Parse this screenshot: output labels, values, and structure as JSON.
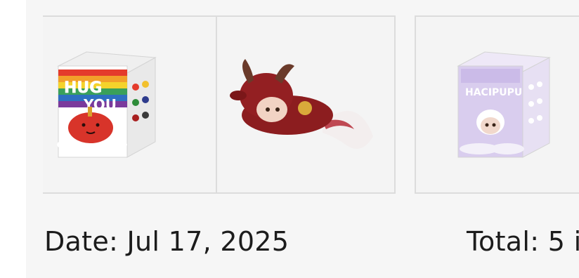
{
  "order": {
    "date_text": "Date: Jul 17, 2025",
    "total_text": "Total: 5 i"
  },
  "products": [
    {
      "name": "product-box-hug-you",
      "box_text": "HUG YOU",
      "colors": {
        "rainbow": [
          "#e43b2c",
          "#f2a02a",
          "#f4d32b",
          "#3aa05a",
          "#2e6fc0",
          "#7a3a9c"
        ],
        "figure": "#d8342a"
      }
    },
    {
      "name": "product-figure-dragon-plush",
      "colors": {
        "body": "#8c1d1f",
        "tail": "#f3eeee",
        "medal": "#d9a93a"
      }
    },
    {
      "name": "product-box-hacipupu",
      "box_text": "HACIPUPU",
      "colors": {
        "box": "#d9cdee",
        "accent": "#b8a6e0"
      }
    }
  ],
  "colors": {
    "panel_bg": "#f6f6f6",
    "thumb_border": "#dcdcdc",
    "text": "#1c1c1c"
  }
}
